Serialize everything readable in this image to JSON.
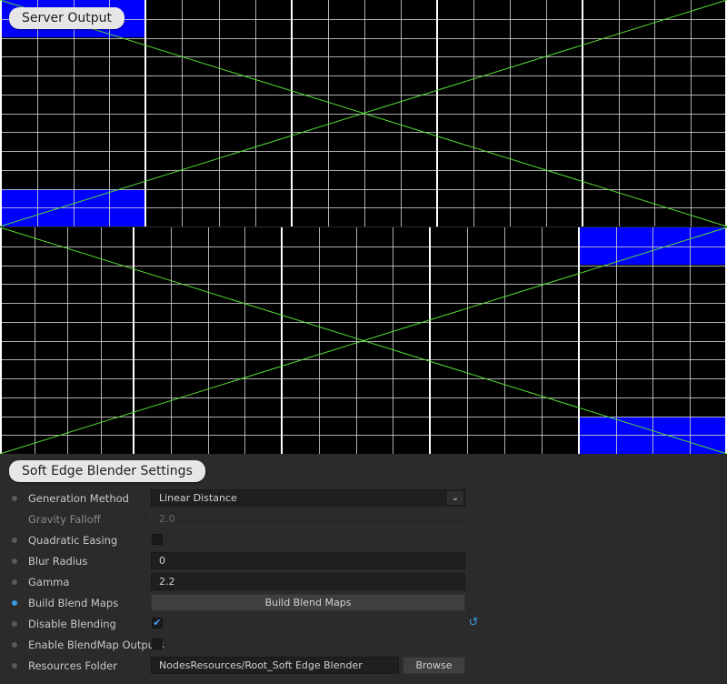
{
  "output_panel": {
    "title": "Server Output"
  },
  "settings_panel": {
    "title": "Soft Edge Blender Settings",
    "generation_method": {
      "label": "Generation Method",
      "value": "Linear Distance"
    },
    "gravity_falloff": {
      "label": "Gravity Falloff",
      "value": "2.0",
      "enabled": false
    },
    "quadratic_easing": {
      "label": "Quadratic Easing",
      "checked": false
    },
    "blur_radius": {
      "label": "Blur Radius",
      "value": "0"
    },
    "gamma": {
      "label": "Gamma",
      "value": "2.2"
    },
    "build_blend_maps": {
      "label": "Build Blend Maps",
      "button_label": "Build Blend Maps"
    },
    "disable_blending": {
      "label": "Disable Blending",
      "checked": true
    },
    "enable_blendmap_outputs": {
      "label": "Enable BlendMap Outputs",
      "checked": false
    },
    "resources_folder": {
      "label": "Resources Folder",
      "value": "NodesResources/Root_Soft Edge Blender",
      "browse_label": "Browse"
    }
  },
  "colors": {
    "accent": "#3b9ae1",
    "blend_region": "#0000ff",
    "diagonal": "#55dd33",
    "grid_line": "#cccccc",
    "major_grid_line": "#ffffff",
    "background": "#2b2b2b"
  }
}
